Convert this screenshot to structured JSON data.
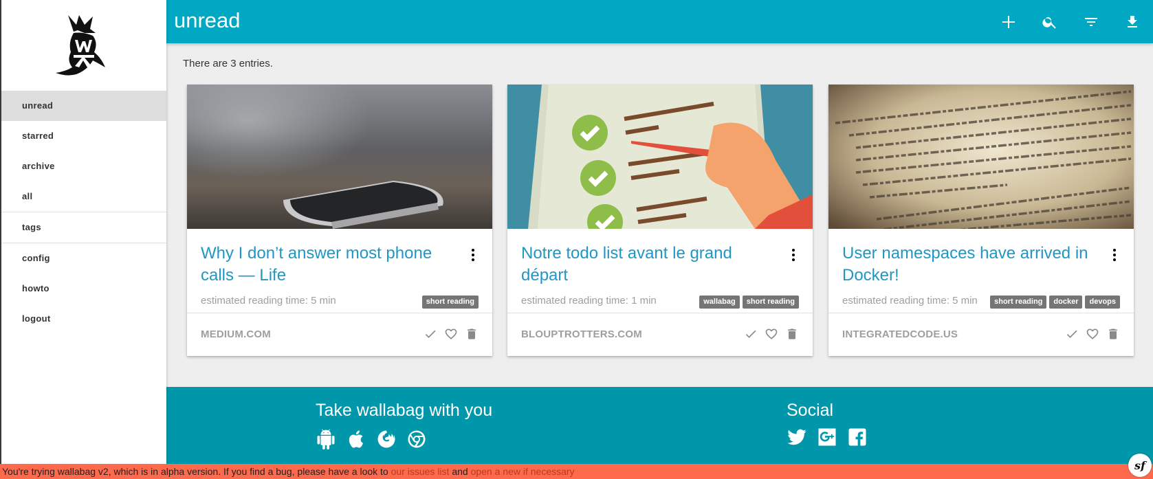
{
  "sidebar": {
    "logo": "wallabag-logo",
    "items": [
      {
        "label": "unread",
        "active": true
      },
      {
        "label": "starred"
      },
      {
        "label": "archive"
      },
      {
        "label": "all"
      },
      {
        "label": "tags"
      },
      {
        "label": "config"
      },
      {
        "label": "howto"
      },
      {
        "label": "logout"
      }
    ]
  },
  "topbar": {
    "title": "unread",
    "actions": [
      "plus-icon",
      "search-icon",
      "filter-icon",
      "download-icon"
    ]
  },
  "main": {
    "entries_count": "There are 3 entries."
  },
  "cards": [
    {
      "title": "Why I don’t answer most phone calls — Life",
      "reading_time": "estimated reading time: 5 min",
      "tags": [
        "short reading"
      ],
      "domain": "MEDIUM.COM"
    },
    {
      "title": "Notre todo list avant le grand départ",
      "reading_time": "estimated reading time: 1 min",
      "tags": [
        "wallabag",
        "short reading"
      ],
      "domain": "BLOUPTROTTERS.COM"
    },
    {
      "title": "User namespaces have arrived in Docker!",
      "reading_time": "estimated reading time: 5 min",
      "tags": [
        "short reading",
        "docker",
        "devops"
      ],
      "domain": "INTEGRATEDCODE.US"
    }
  ],
  "footer": {
    "apps_heading": "Take wallabag with you",
    "apps_icons": [
      "android-icon",
      "apple-icon",
      "firefox-icon",
      "chrome-icon"
    ],
    "social_heading": "Social",
    "social_icons": [
      "twitter-icon",
      "google-plus-icon",
      "facebook-icon"
    ]
  },
  "alert": {
    "text_before": "You're trying wallabag v2, which is in alpha version. If you find a bug, please have a look to ",
    "link1": "our issues list",
    "text_middle": " and ",
    "link2": "open a new if necessary"
  },
  "colors": {
    "topbar": "#00a8c3",
    "footer": "#0097ab",
    "alert": "#ff6a4d",
    "title_link": "#2196c6"
  }
}
